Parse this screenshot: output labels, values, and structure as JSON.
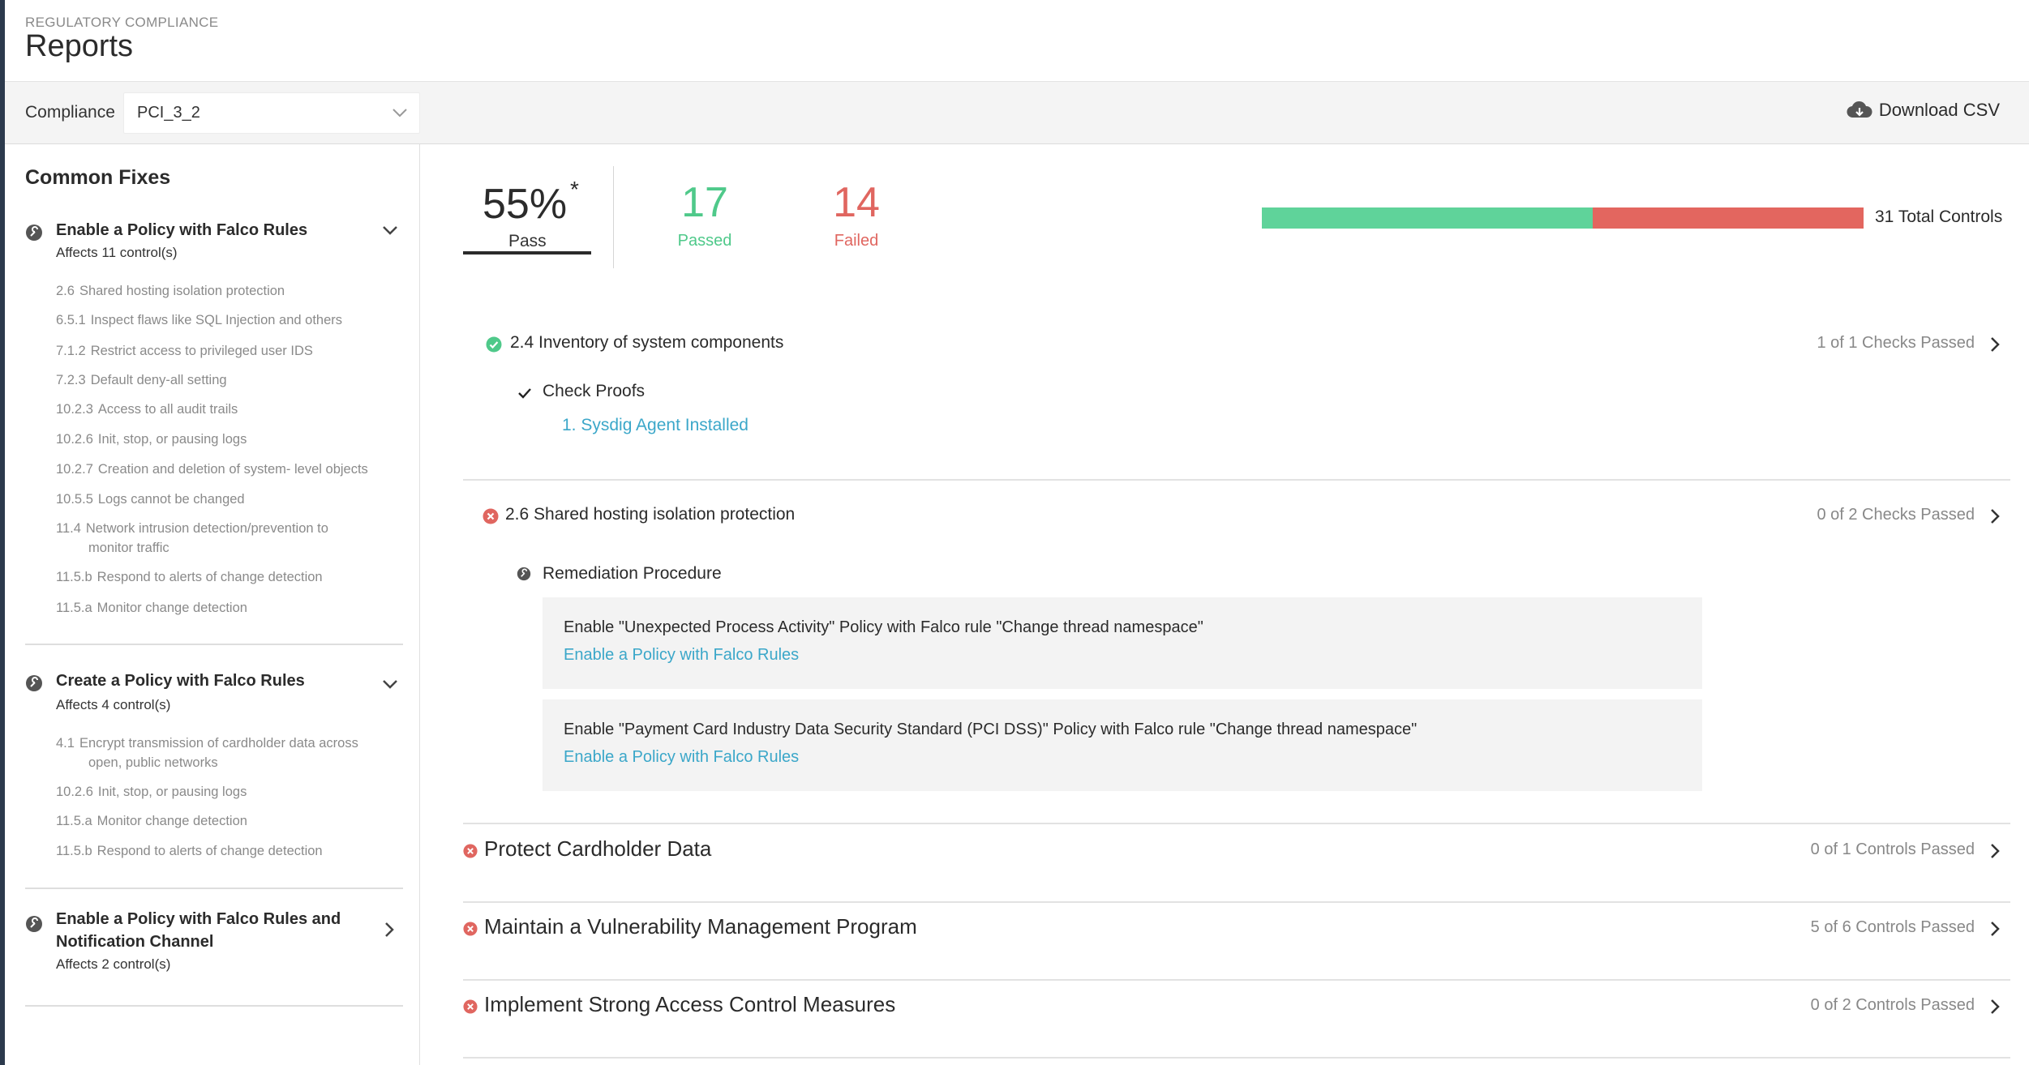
{
  "header": {
    "eyebrow": "REGULATORY COMPLIANCE",
    "title": "Reports"
  },
  "filter": {
    "label": "Compliance",
    "selected": "PCI_3_2",
    "download_label": "Download CSV"
  },
  "sidebar": {
    "title": "Common Fixes",
    "fixes": [
      {
        "name": "Enable a Policy with Falco Rules",
        "affects": "Affects 11 control(s)",
        "items": [
          {
            "num": "2.6",
            "text": "Shared hosting isolation protection"
          },
          {
            "num": "6.5.1",
            "text": "Inspect flaws like SQL Injection and others"
          },
          {
            "num": "7.1.2",
            "text": "Restrict access to privileged user IDS"
          },
          {
            "num": "7.2.3",
            "text": "Default deny-all setting"
          },
          {
            "num": "10.2.3",
            "text": "Access to all audit trails"
          },
          {
            "num": "10.2.6",
            "text": "Init, stop, or pausing logs"
          },
          {
            "num": "10.2.7",
            "text": "Creation and deletion of system- level objects"
          },
          {
            "num": "10.5.5",
            "text": "Logs cannot be changed"
          },
          {
            "num": "11.4",
            "text": "Network intrusion detection/prevention to",
            "cont": "monitor traffic"
          },
          {
            "num": "11.5.b",
            "text": "Respond to alerts of change detection"
          },
          {
            "num": "11.5.a",
            "text": "Monitor change detection"
          }
        ]
      },
      {
        "name": "Create a Policy with Falco Rules",
        "affects": "Affects 4 control(s)",
        "items": [
          {
            "num": "4.1",
            "text": "Encrypt transmission of cardholder data across",
            "cont": "open, public networks"
          },
          {
            "num": "10.2.6",
            "text": "Init, stop, or pausing logs"
          },
          {
            "num": "11.5.a",
            "text": "Monitor change detection"
          },
          {
            "num": "11.5.b",
            "text": "Respond to alerts of change detection"
          }
        ]
      },
      {
        "name_line1": "Enable a Policy with Falco Rules and",
        "name_line2": "Notification Channel",
        "affects": "Affects 2 control(s)"
      }
    ]
  },
  "summary": {
    "pass_pct": "55%",
    "star": "*",
    "pass_label": "Pass",
    "passed_count": "17",
    "passed_label": "Passed",
    "failed_count": "14",
    "failed_label": "Failed",
    "pass_fraction": 0.55,
    "total_label": "31 Total Controls"
  },
  "controls": [
    {
      "name": "2.4 Inventory of system components",
      "checks": "1 of 1 Checks Passed",
      "status": "pass",
      "section_label": "Check Proofs",
      "proof": "1. Sysdig Agent Installed"
    },
    {
      "name": "2.6 Shared hosting isolation protection",
      "checks": "0 of 2 Checks Passed",
      "status": "fail",
      "section_label": "Remediation Procedure",
      "remediations": [
        {
          "text": "Enable \"Unexpected Process Activity\" Policy with Falco rule \"Change thread namespace\"",
          "link": "Enable a Policy with Falco Rules"
        },
        {
          "text": "Enable \"Payment Card Industry Data Security Standard (PCI DSS)\" Policy with Falco rule \"Change thread namespace\"",
          "link": "Enable a Policy with Falco Rules"
        }
      ]
    }
  ],
  "groups": [
    {
      "name": "Protect Cardholder Data",
      "status": "0 of 1 Controls Passed"
    },
    {
      "name": "Maintain a Vulnerability Management Program",
      "status": "5 of 6 Controls Passed"
    },
    {
      "name": "Implement Strong Access Control Measures",
      "status": "0 of 2 Controls Passed"
    }
  ],
  "colors": {
    "pass": "#4fc98a",
    "fail": "#e06660",
    "link": "#3ba7c9",
    "sidebar_strip": "#2c3a4d"
  },
  "icons": {
    "fix": "wrench-icon",
    "pass": "check-circle-icon",
    "fail": "x-circle-icon",
    "download": "cloud-download-icon"
  }
}
